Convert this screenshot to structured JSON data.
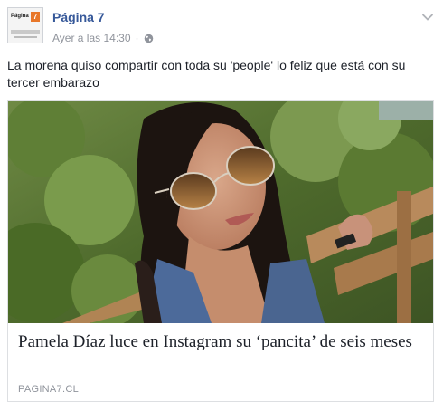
{
  "post": {
    "page_name": "Página 7",
    "timestamp": "Ayer a las 14:30",
    "separator": "·",
    "privacy_icon": "globe-icon",
    "menu_icon": "chevron-down-icon",
    "message": "La morena quiso compartir con toda su 'people' lo feliz que está con su tercer embarazo"
  },
  "avatar": {
    "logo_text": "Página",
    "logo_mark": "7"
  },
  "link_card": {
    "image_alt": "Mujer con gafas de sol tomándose una selfie",
    "headline": "Pamela Díaz luce en Instagram su ‘pancita’ de seis meses",
    "domain": "PAGINA7.CL"
  },
  "colors": {
    "link_blue": "#365899",
    "meta_gray": "#90949c",
    "text": "#1d2129",
    "border": "#dddfe2"
  }
}
